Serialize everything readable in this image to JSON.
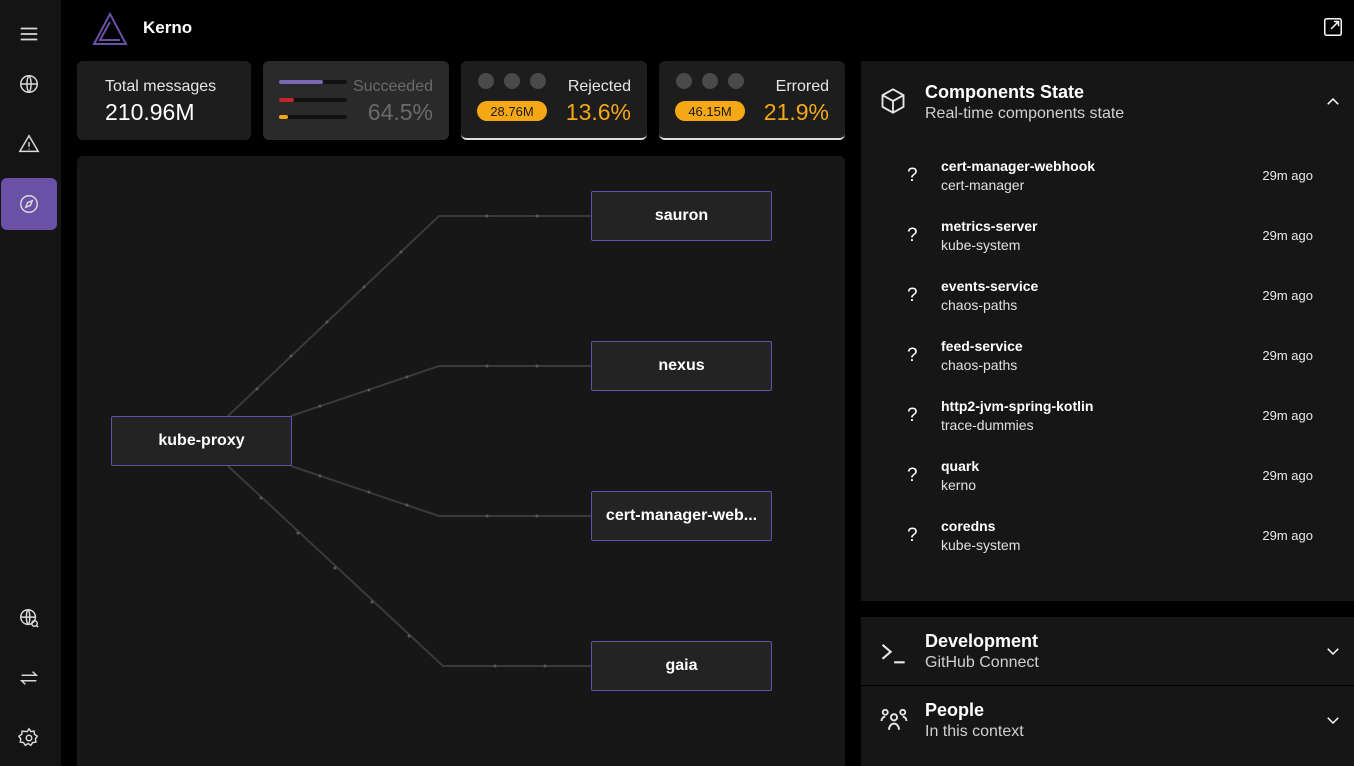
{
  "app": {
    "name": "Kerno"
  },
  "sidebar": {
    "items": [
      {
        "name": "menu-icon"
      },
      {
        "name": "globe-icon"
      },
      {
        "name": "warning-icon"
      },
      {
        "name": "compass-icon",
        "active": true
      },
      {
        "name": "globe-search-icon"
      },
      {
        "name": "swap-icon"
      },
      {
        "name": "settings-icon"
      }
    ]
  },
  "stats": {
    "total": {
      "label": "Total messages",
      "value": "210.96M"
    },
    "succeeded": {
      "label": "Succeeded",
      "value": "64.5%"
    },
    "rejected": {
      "label": "Rejected",
      "count": "28.76M",
      "value": "13.6%"
    },
    "errored": {
      "label": "Errored",
      "count": "46.15M",
      "value": "21.9%"
    }
  },
  "graph": {
    "source": "kube-proxy",
    "targets": [
      "sauron",
      "nexus",
      "cert-manager-web...",
      "gaia"
    ]
  },
  "components_state": {
    "title": "Components State",
    "subtitle": "Real-time components state",
    "items": [
      {
        "status": "?",
        "name": "cert-manager-webhook",
        "namespace": "cert-manager",
        "time": "29m ago"
      },
      {
        "status": "?",
        "name": "metrics-server",
        "namespace": "kube-system",
        "time": "29m ago"
      },
      {
        "status": "?",
        "name": "events-service",
        "namespace": "chaos-paths",
        "time": "29m ago"
      },
      {
        "status": "?",
        "name": "feed-service",
        "namespace": "chaos-paths",
        "time": "29m ago"
      },
      {
        "status": "?",
        "name": "http2-jvm-spring-kotlin",
        "namespace": "trace-dummies",
        "time": "29m ago"
      },
      {
        "status": "?",
        "name": "quark",
        "namespace": "kerno",
        "time": "29m ago"
      },
      {
        "status": "?",
        "name": "coredns",
        "namespace": "kube-system",
        "time": "29m ago"
      }
    ]
  },
  "development": {
    "title": "Development",
    "subtitle": "GitHub Connect"
  },
  "people": {
    "title": "People",
    "subtitle": "In this context"
  },
  "colors": {
    "accent": "#6a51a6",
    "warning": "#f4a815",
    "node_border": "#6352a3",
    "error": "#c0262b"
  }
}
